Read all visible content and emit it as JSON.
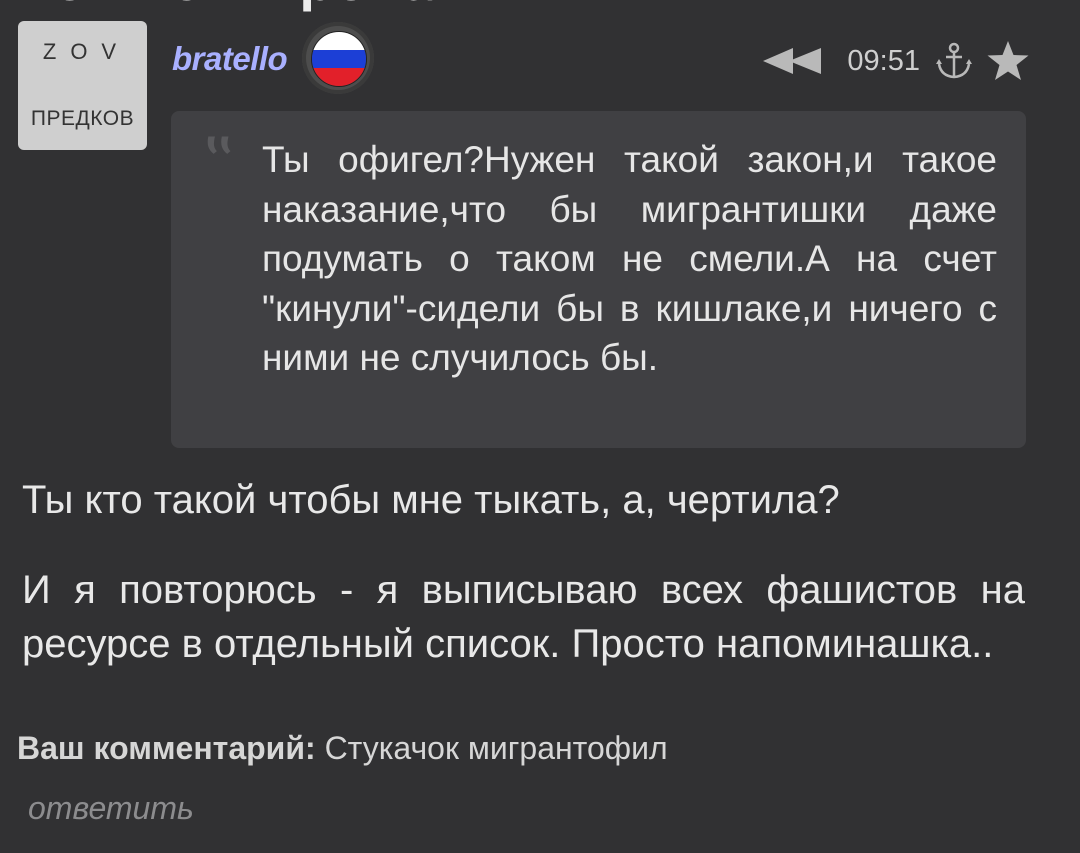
{
  "header": {
    "cut_title": "Комментировать"
  },
  "comment": {
    "avatar": {
      "line1": "ZOV",
      "line2": "ПРЕДКОВ"
    },
    "username": "bratello",
    "flag_colors": [
      "#ffffff",
      "#1c3fd6",
      "#e2202a"
    ],
    "time": "09:51",
    "icons": [
      "rewind-icon",
      "anchor-icon",
      "star-icon"
    ],
    "quote": "Ты офигел?Нужен такой закон,и такое наказание,что бы мигрантишки даже подумать о таком не смели.А на счет \"кинули\"-сидели бы в кишлаке,и ничего с ними не случилось бы.",
    "reply_line1": "Ты кто такой чтобы мне тыкать, а, чертила?",
    "reply_line2": "И я повторюсь - я выписываю всех фашистов на ресурсе в отдельный список. Просто напоминашка..",
    "your_comment_label": "Ваш комментарий:",
    "your_comment_value": "Стукачок мигрантофил",
    "reply_action": "ответить"
  }
}
